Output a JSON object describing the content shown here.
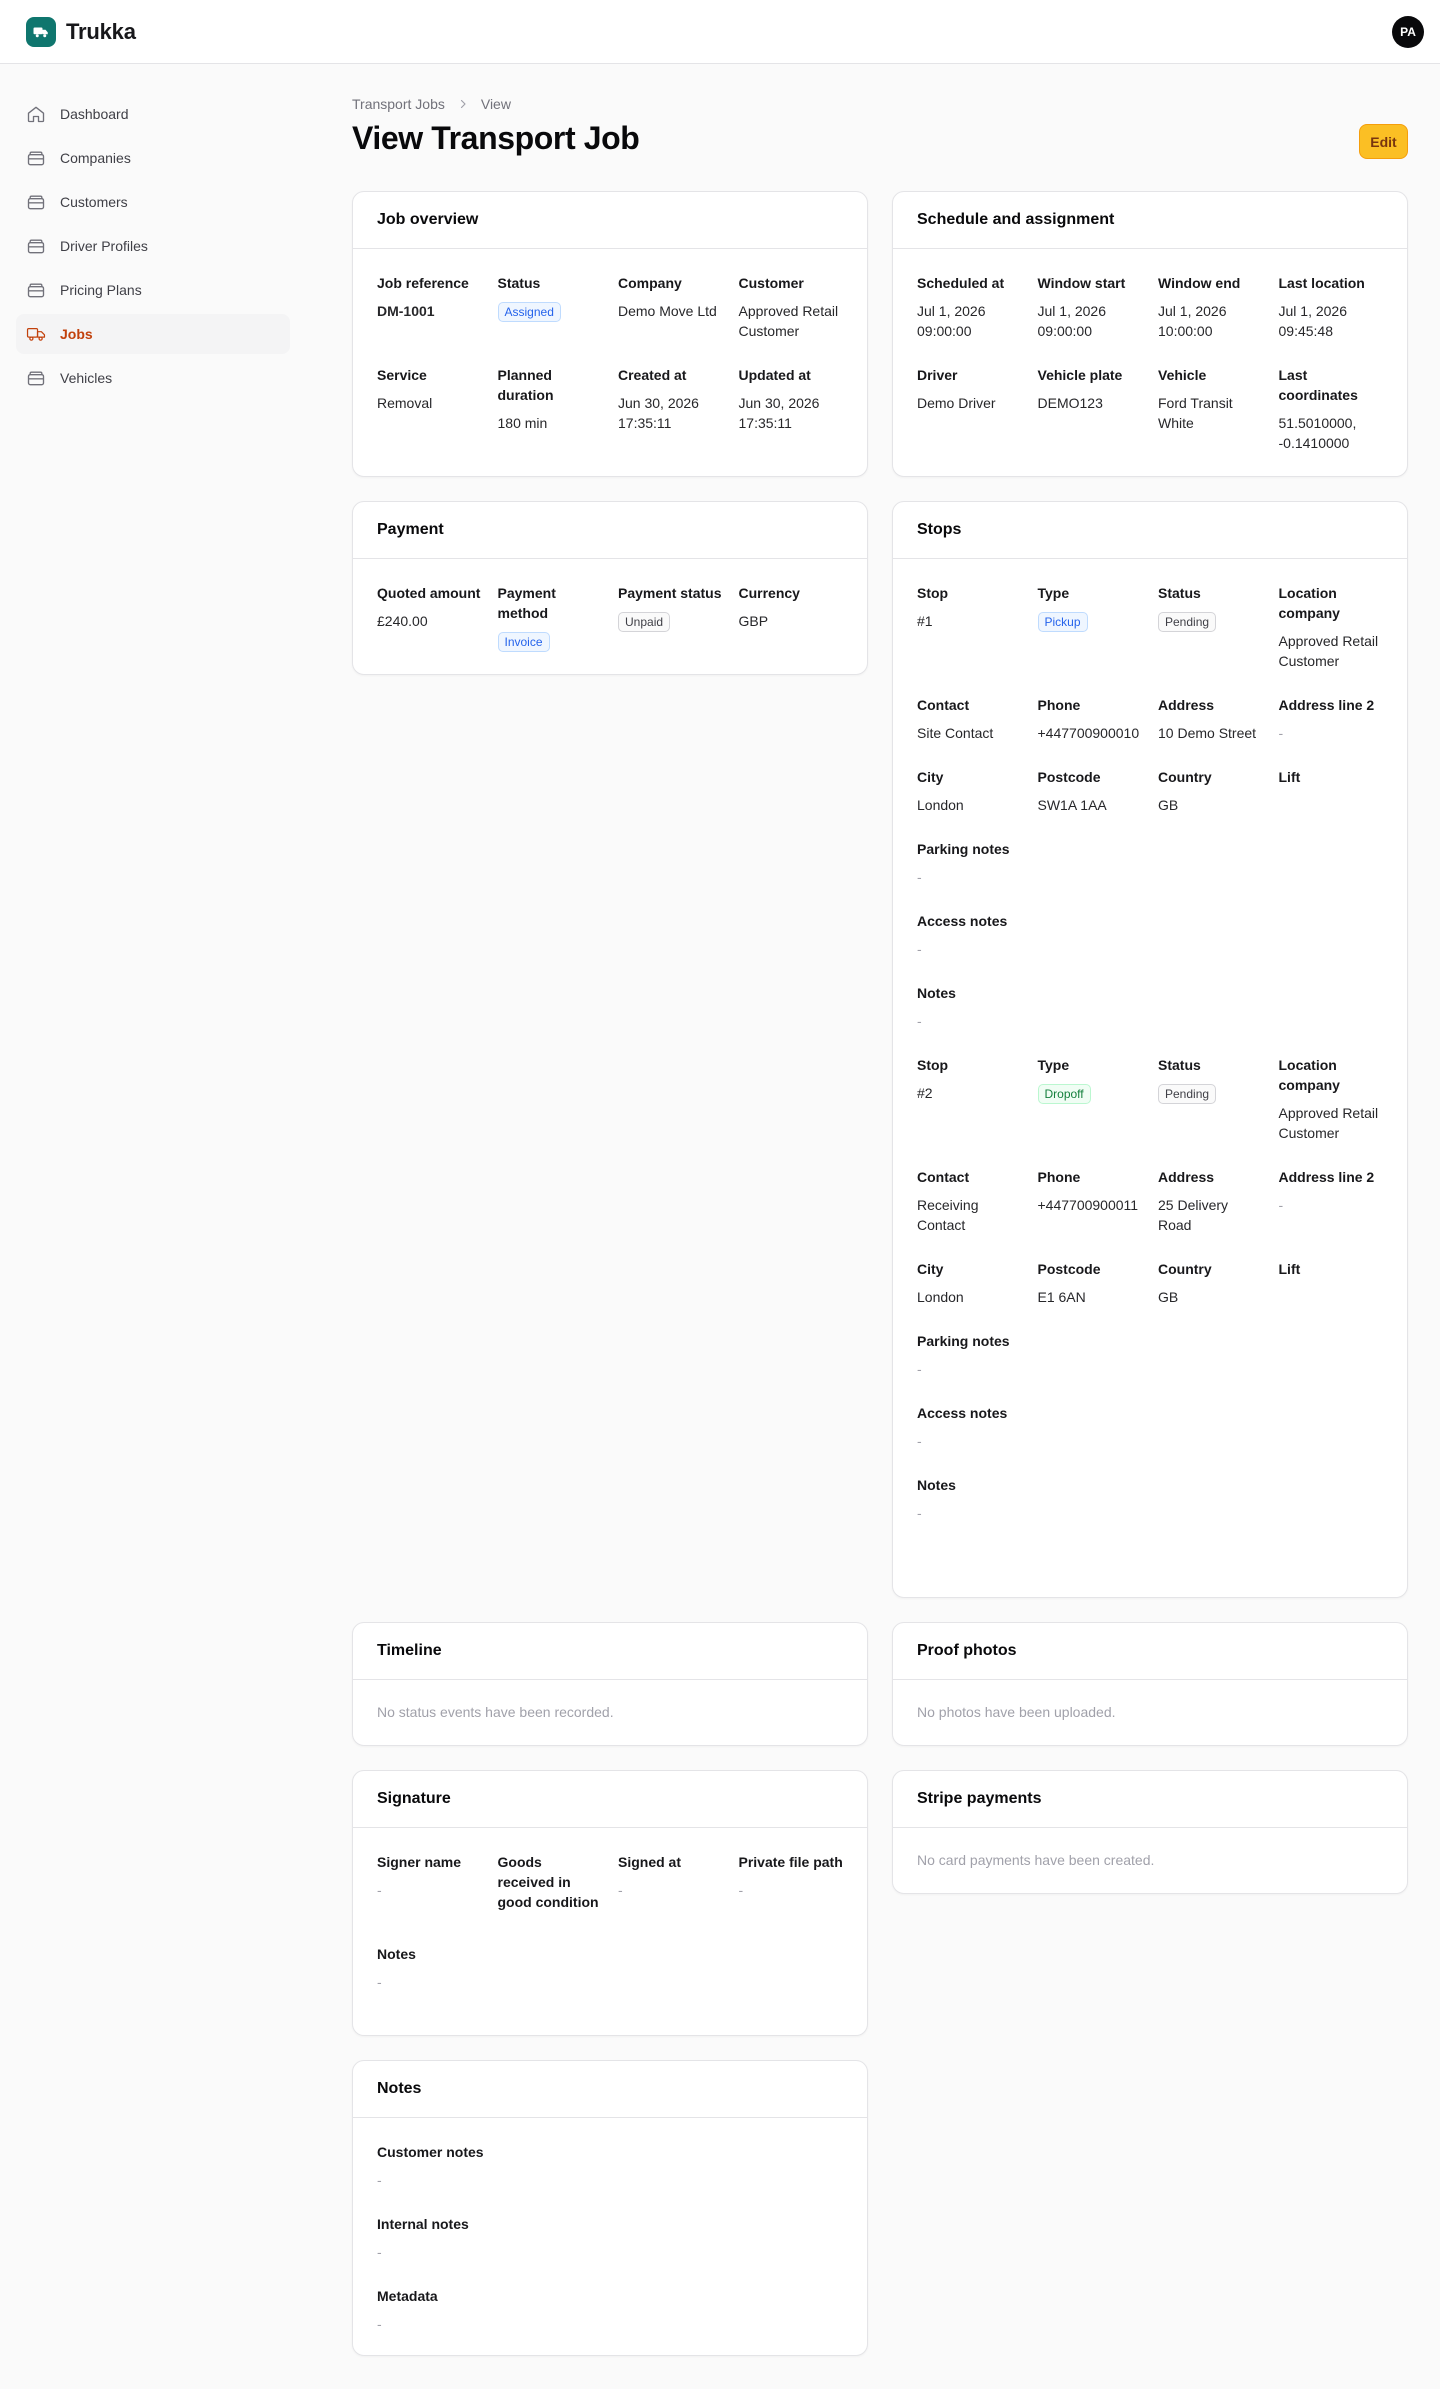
{
  "app": {
    "name": "Trukka",
    "avatar_initials": "PA"
  },
  "sidebar": {
    "items": [
      {
        "label": "Dashboard",
        "icon": "home-icon",
        "active": false
      },
      {
        "label": "Companies",
        "icon": "layers-icon",
        "active": false
      },
      {
        "label": "Customers",
        "icon": "layers-icon",
        "active": false
      },
      {
        "label": "Driver Profiles",
        "icon": "layers-icon",
        "active": false
      },
      {
        "label": "Pricing Plans",
        "icon": "layers-icon",
        "active": false
      },
      {
        "label": "Jobs",
        "icon": "truck-icon",
        "active": true
      },
      {
        "label": "Vehicles",
        "icon": "layers-icon",
        "active": false
      }
    ]
  },
  "breadcrumb": {
    "parent": "Transport Jobs",
    "current": "View"
  },
  "page": {
    "title": "View Transport Job",
    "edit_label": "Edit"
  },
  "job_overview": {
    "title": "Job overview",
    "job_reference": {
      "label": "Job reference",
      "value": "DM-1001"
    },
    "status": {
      "label": "Status",
      "value": "Assigned"
    },
    "company": {
      "label": "Company",
      "value": "Demo Move Ltd"
    },
    "customer": {
      "label": "Customer",
      "value": "Approved Retail Customer"
    },
    "service": {
      "label": "Service",
      "value": "Removal"
    },
    "planned_duration": {
      "label": "Planned duration",
      "value": "180 min"
    },
    "created_at": {
      "label": "Created at",
      "value": "Jun 30, 2026 17:35:11"
    },
    "updated_at": {
      "label": "Updated at",
      "value": "Jun 30, 2026 17:35:11"
    }
  },
  "schedule": {
    "title": "Schedule and assignment",
    "scheduled_at": {
      "label": "Scheduled at",
      "value": "Jul 1, 2026 09:00:00"
    },
    "window_start": {
      "label": "Window start",
      "value": "Jul 1, 2026 09:00:00"
    },
    "window_end": {
      "label": "Window end",
      "value": "Jul 1, 2026 10:00:00"
    },
    "last_location": {
      "label": "Last location",
      "value": "Jul 1, 2026 09:45:48"
    },
    "driver": {
      "label": "Driver",
      "value": "Demo Driver"
    },
    "vehicle_plate": {
      "label": "Vehicle plate",
      "value": "DEMO123"
    },
    "vehicle": {
      "label": "Vehicle",
      "value": "Ford Transit White"
    },
    "last_coordinates": {
      "label": "Last coordinates",
      "value": "51.5010000, -0.1410000"
    }
  },
  "payment": {
    "title": "Payment",
    "quoted_amount": {
      "label": "Quoted amount",
      "value": "£240.00"
    },
    "payment_method": {
      "label": "Payment method",
      "value": "Invoice"
    },
    "payment_status": {
      "label": "Payment status",
      "value": "Unpaid"
    },
    "currency": {
      "label": "Currency",
      "value": "GBP"
    }
  },
  "stops": {
    "title": "Stops",
    "labels": {
      "stop": "Stop",
      "type": "Type",
      "status": "Status",
      "location_company": "Location company",
      "contact": "Contact",
      "phone": "Phone",
      "address": "Address",
      "address_line_2": "Address line 2",
      "city": "City",
      "postcode": "Postcode",
      "country": "Country",
      "lift": "Lift",
      "parking_notes": "Parking notes",
      "access_notes": "Access notes",
      "notes": "Notes"
    },
    "items": [
      {
        "stop": "#1",
        "type": "Pickup",
        "status": "Pending",
        "location_company": "Approved Retail Customer",
        "contact": "Site Contact",
        "phone": "+447700900010",
        "address": "10 Demo Street",
        "address_line_2": "-",
        "city": "London",
        "postcode": "SW1A 1AA",
        "country": "GB",
        "lift": "",
        "parking_notes": "-",
        "access_notes": "-",
        "notes": "-"
      },
      {
        "stop": "#2",
        "type": "Dropoff",
        "status": "Pending",
        "location_company": "Approved Retail Customer",
        "contact": "Receiving Contact",
        "phone": "+447700900011",
        "address": "25 Delivery Road",
        "address_line_2": "-",
        "city": "London",
        "postcode": "E1 6AN",
        "country": "GB",
        "lift": "",
        "parking_notes": "-",
        "access_notes": "-",
        "notes": "-"
      }
    ]
  },
  "timeline": {
    "title": "Timeline",
    "empty": "No status events have been recorded."
  },
  "proof_photos": {
    "title": "Proof photos",
    "empty": "No photos have been uploaded."
  },
  "signature": {
    "title": "Signature",
    "signer_name": {
      "label": "Signer name",
      "value": "-"
    },
    "goods_received": {
      "label": "Goods received in good condition",
      "value": ""
    },
    "signed_at": {
      "label": "Signed at",
      "value": "-"
    },
    "private_file_path": {
      "label": "Private file path",
      "value": "-"
    },
    "notes": {
      "label": "Notes",
      "value": "-"
    }
  },
  "stripe_payments": {
    "title": "Stripe payments",
    "empty": "No card payments have been created."
  },
  "notes": {
    "title": "Notes",
    "customer_notes": {
      "label": "Customer notes",
      "value": "-"
    },
    "internal_notes": {
      "label": "Internal notes",
      "value": "-"
    },
    "metadata": {
      "label": "Metadata",
      "value": "-"
    }
  },
  "colors": {
    "brand": "#0f766e",
    "accent": "#c2410c",
    "edit_button": "#fbbf24"
  }
}
